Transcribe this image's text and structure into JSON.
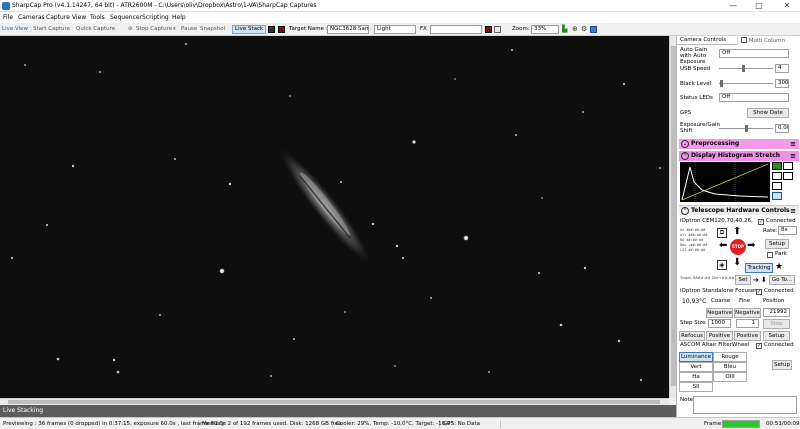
{
  "window": {
    "title": "SharpCap Pro (v4.1.14247, 64 bit) - ATR2600M - C:\\Users\\oliv\\Dropbox\\Astro\\1-VA\\SharpCap Captures",
    "minimize": "—",
    "maximize": "□",
    "close": "✕"
  },
  "menu": {
    "items": [
      "File",
      "Cameras",
      "Capture",
      "View",
      "Tools",
      "Sequencer",
      "Scripting",
      "Help"
    ]
  },
  "toolbar": {
    "live_view": "Live View",
    "start_capture": "Start Capture",
    "quick_capture": "Quick Capture",
    "stop_capture": "Stop Capture",
    "pause": "Pause",
    "snapshot": "Snapshot",
    "live_stack": "Live Stack",
    "target_name_label": "Target Name :",
    "target_name_value": "NGC3628 Sam",
    "light_value": "Light",
    "fx_label": "FX",
    "fx_value": "",
    "zoom_label": "Zoom:",
    "zoom_value": "33%"
  },
  "panel": {
    "tab_controls": "Camera Controls",
    "tab_multicolumn": "Multi Column",
    "auto_gain_label": "Auto Gain with Auto Exposure",
    "auto_gain_value": "Off",
    "usb_speed_label": "USB Speed",
    "usb_speed_value": "4",
    "usb_speed_level": 0.45,
    "black_level_label": "Black Level",
    "black_level_value": "300",
    "black_level_level": 0.05,
    "status_leds_label": "Status LEDs",
    "status_leds_value": "Off",
    "gps_label": "GPS",
    "show_date_btn": "Show Date",
    "exposure_shift_label": "Exposure/Gain Shift",
    "exposure_shift_value": "0.00",
    "exposure_shift_level": 0.5,
    "preprocessing": "Preprocessing",
    "histogram": "Display Histogram Stretch",
    "telescope": "Telescope Hardware Controls",
    "mount_name": "iOptron CEM120,70,40,26,",
    "connected": "Connected",
    "rate_label": "Rate:",
    "rate_value": "8x",
    "setup": "Setup",
    "park": "Park",
    "stop": "STOP",
    "tracking": "Tracking",
    "set": "Set",
    "goto": "Go To...",
    "coords": [
      "Az   ###:##:##",
      "Alt  ###:##:##",
      "RA   ##:##:##",
      "Dec  +##:##:##",
      "LST  ##:##:##"
    ],
    "coords_footer": "Target: RA##:##  Dec+##:##",
    "focuser_name": "iOptron Standalone Focuser",
    "focuser_temp": "10,93°C",
    "coarse": "Coarse",
    "fine": "Fine",
    "position": "Position",
    "negative": "Negative",
    "position_value": "21992",
    "step_size_label": "Step Size",
    "step_coarse": "1000",
    "step_fine": "1",
    "refocus": "Refocus",
    "positive": "Positive",
    "filterwheel_name": "ASCOM Altair FilterWheel",
    "filters": [
      "Luminance",
      "Rouge",
      "Vert",
      "Bleu",
      "Ha",
      "OIII",
      "SII"
    ],
    "notes_label": "Notes"
  },
  "live_stacking_label": "Live Stacking",
  "status": {
    "previewing": "Previewing : 36 frames (0 dropped) in 0:37:15, exposure 60.0s , last frame 60.0s",
    "memory": "Memory: 2 of 192 frames used. Disk: 1268 GB free",
    "cooler": "Cooler: 29%, Temp: -10,0°C, Target: -10,0°",
    "gps": "GPS: No Data",
    "frame_label": "Frame:",
    "frame_progress": 1.0,
    "frame_time": "00:51/00:09"
  },
  "colors": {
    "preprocessing_bg": "#f39be8",
    "histogram_bg": "#ef8fe6",
    "telescope_bg": "#e9e9e9",
    "accent": "#cfe3f7",
    "progress": "#2ec52e",
    "stop_red": "#e02020"
  },
  "icons": {
    "live_view": "camera-icon",
    "zoom": "zoom-icon",
    "histogram": "histogram-icon"
  }
}
